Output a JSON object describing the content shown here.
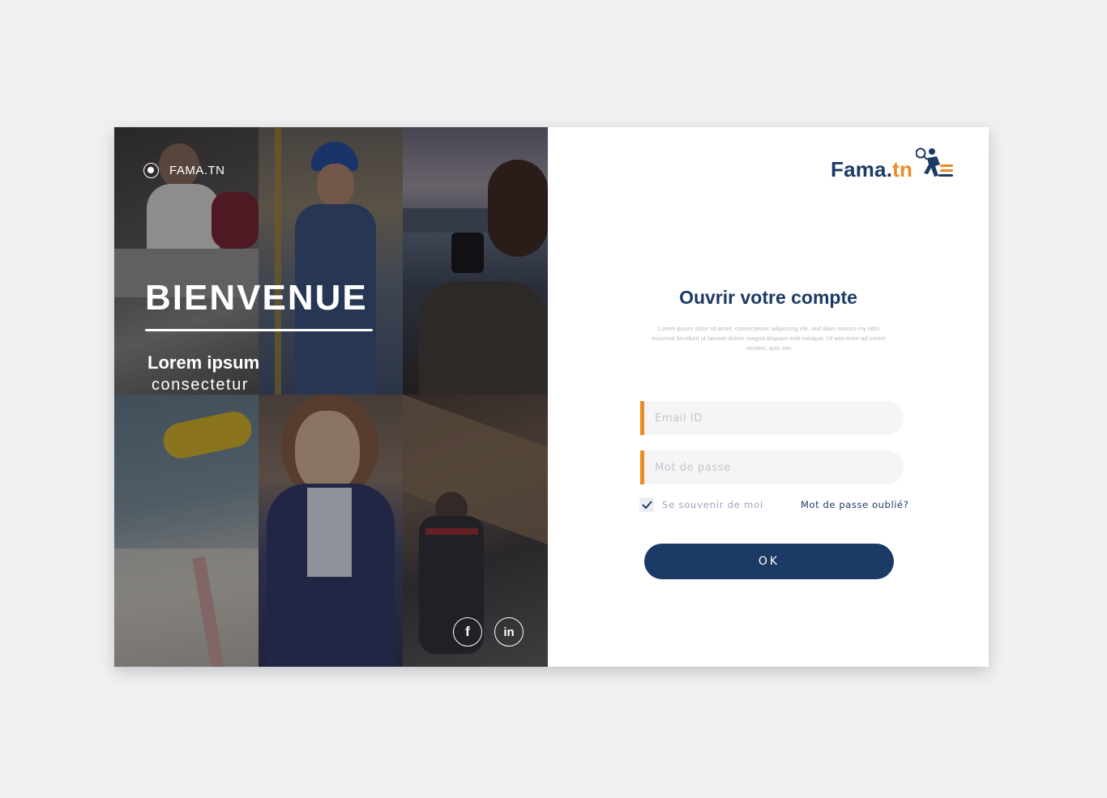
{
  "brand": {
    "left_label": "FAMA.TN",
    "logo_text_main": "Fama.",
    "logo_text_accent": "tn"
  },
  "hero": {
    "title": "BIENVENUE",
    "subtitle": "Lorem ipsum",
    "tagline": "consectetur"
  },
  "social": {
    "facebook_glyph": "f",
    "linkedin_glyph": "in"
  },
  "form": {
    "title": "Ouvrir votre compte",
    "description": "Lorem ipsum dolor sit amet, consectetuer adipiscing elit, sed diam nonum-my nibh euismod tincidunt ut laoreet dolore magna aliquam erat volutpat. Ut wisi enim ad minim veniam, quis nos",
    "email_placeholder": "Email ID",
    "password_placeholder": "Mot de passe",
    "remember_label": "Se souvenir de moi",
    "remember_checked": true,
    "forgot_label": "Mot de passe oublié?",
    "submit_label": "OK"
  },
  "colors": {
    "navy": "#1c3a66",
    "orange": "#ec8a23",
    "background": "#eff0f2"
  }
}
